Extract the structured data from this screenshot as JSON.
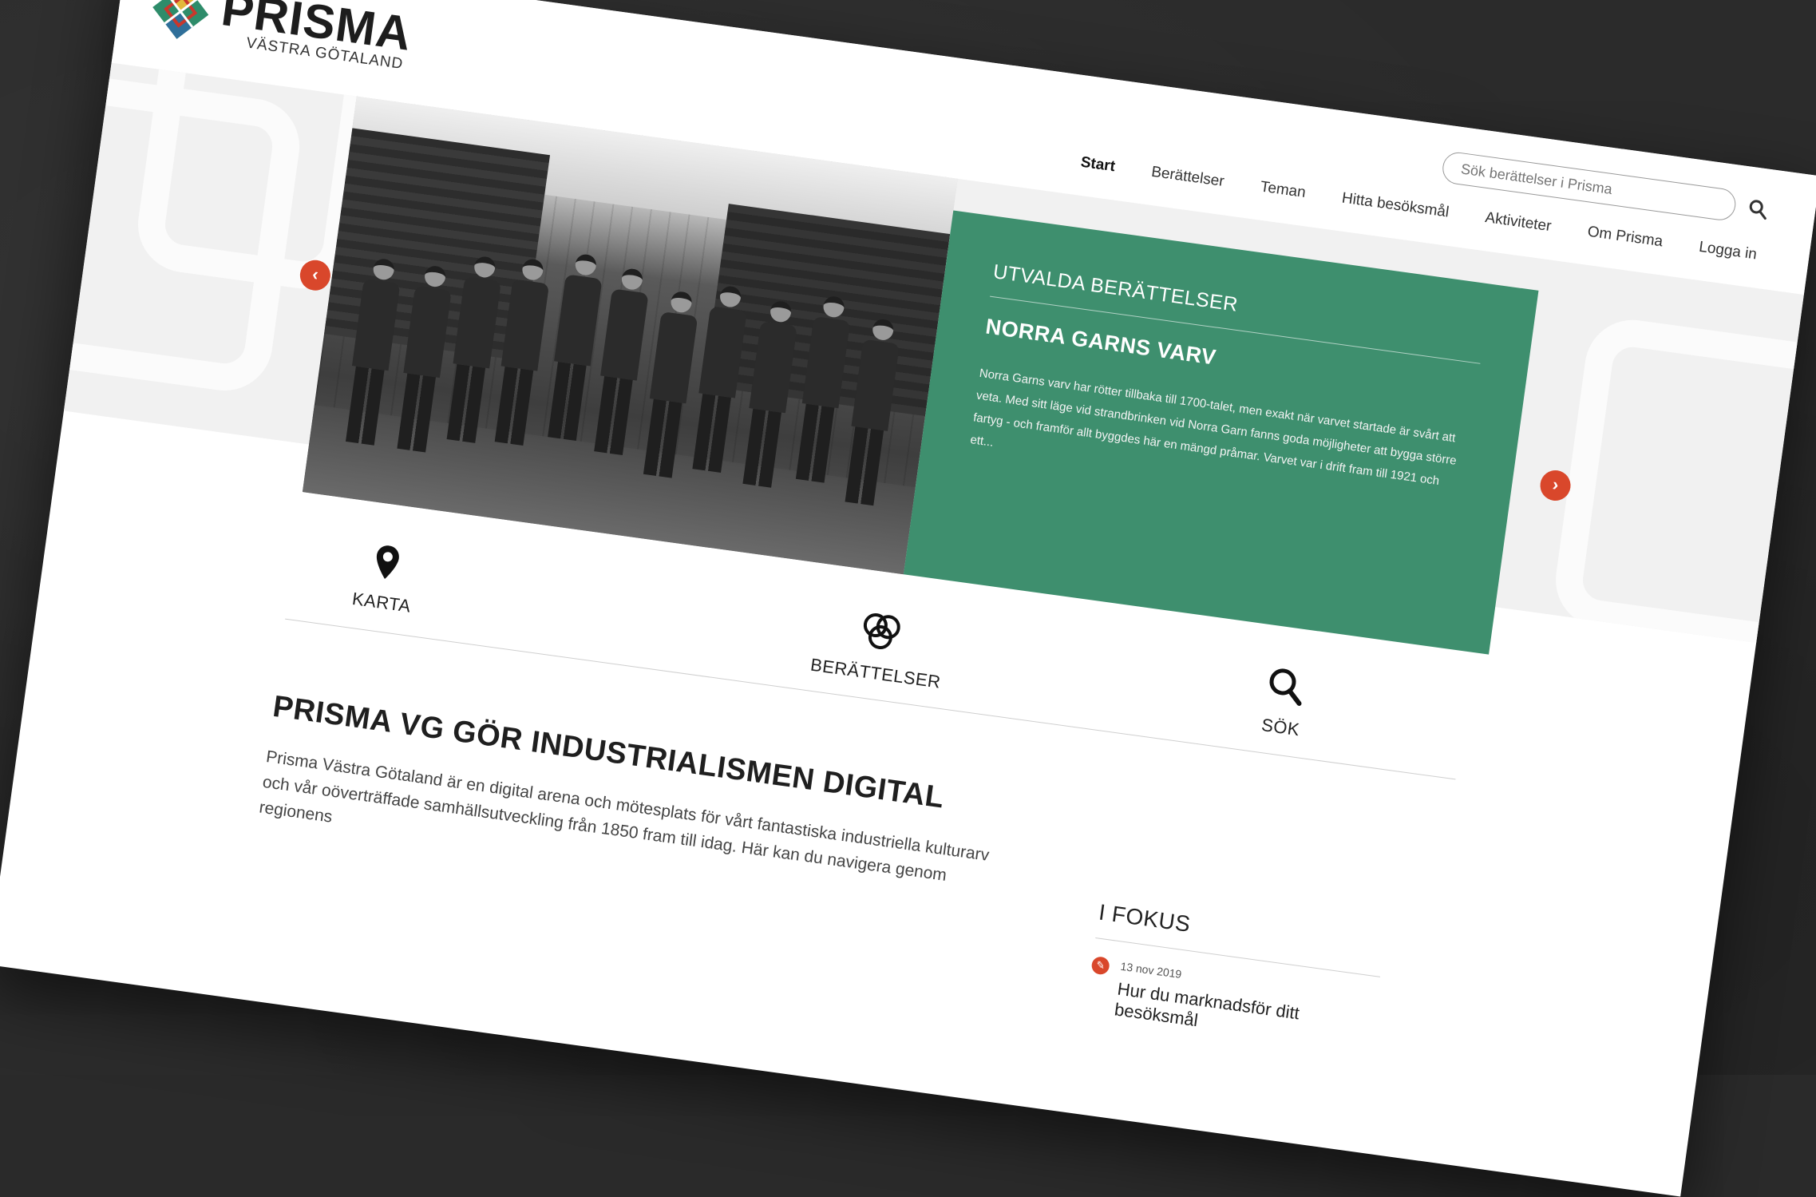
{
  "brand": {
    "name": "PRISMA",
    "subtitle": "VÄSTRA GÖTALAND"
  },
  "search": {
    "placeholder": "Sök berättelser i Prisma"
  },
  "nav": {
    "items": [
      {
        "label": "Start",
        "active": true
      },
      {
        "label": "Berättelser"
      },
      {
        "label": "Teman"
      },
      {
        "label": "Hitta besöksmål"
      },
      {
        "label": "Aktiviteter"
      },
      {
        "label": "Om Prisma"
      },
      {
        "label": "Logga in"
      }
    ]
  },
  "hero": {
    "kicker": "UTVALDA BERÄTTELSER",
    "title": "NORRA GARNS VARV",
    "text": "Norra Garns varv har rötter tillbaka till 1700-talet, men exakt när varvet startade är svårt att veta. Med sitt läge vid strandbrinken vid Norra Garn fanns goda möjligheter att bygga större fartyg - och framför allt byggdes här en mängd pråmar. Varvet var i drift fram till 1921 och ett...",
    "prev_arrow": "‹",
    "next_arrow": "›"
  },
  "quick_links": {
    "map": "KARTA",
    "stories": "BERÄTTELSER",
    "search": "SÖK"
  },
  "main": {
    "heading": "PRISMA VG GÖR INDUSTRIALISMEN DIGITAL",
    "lead": "Prisma Västra Götaland är en digital arena och mötesplats för vårt fantastiska industriella kulturarv och vår oöverträffade samhällsutveckling från 1850 fram till idag.  Här kan du navigera genom regionens"
  },
  "focus": {
    "title": "I FOKUS",
    "items": [
      {
        "date": "13 nov 2019",
        "headline": "Hur du marknadsför ditt besöksmål"
      }
    ]
  },
  "colors": {
    "accent_green": "#3e8f6e",
    "accent_red": "#d9472b",
    "background": "#2a2a2a"
  },
  "icons": {
    "logo": "prisma-logo-icon",
    "search": "search-icon",
    "map": "map-pin-icon",
    "stories": "rings-icon",
    "edit": "pencil-icon"
  }
}
